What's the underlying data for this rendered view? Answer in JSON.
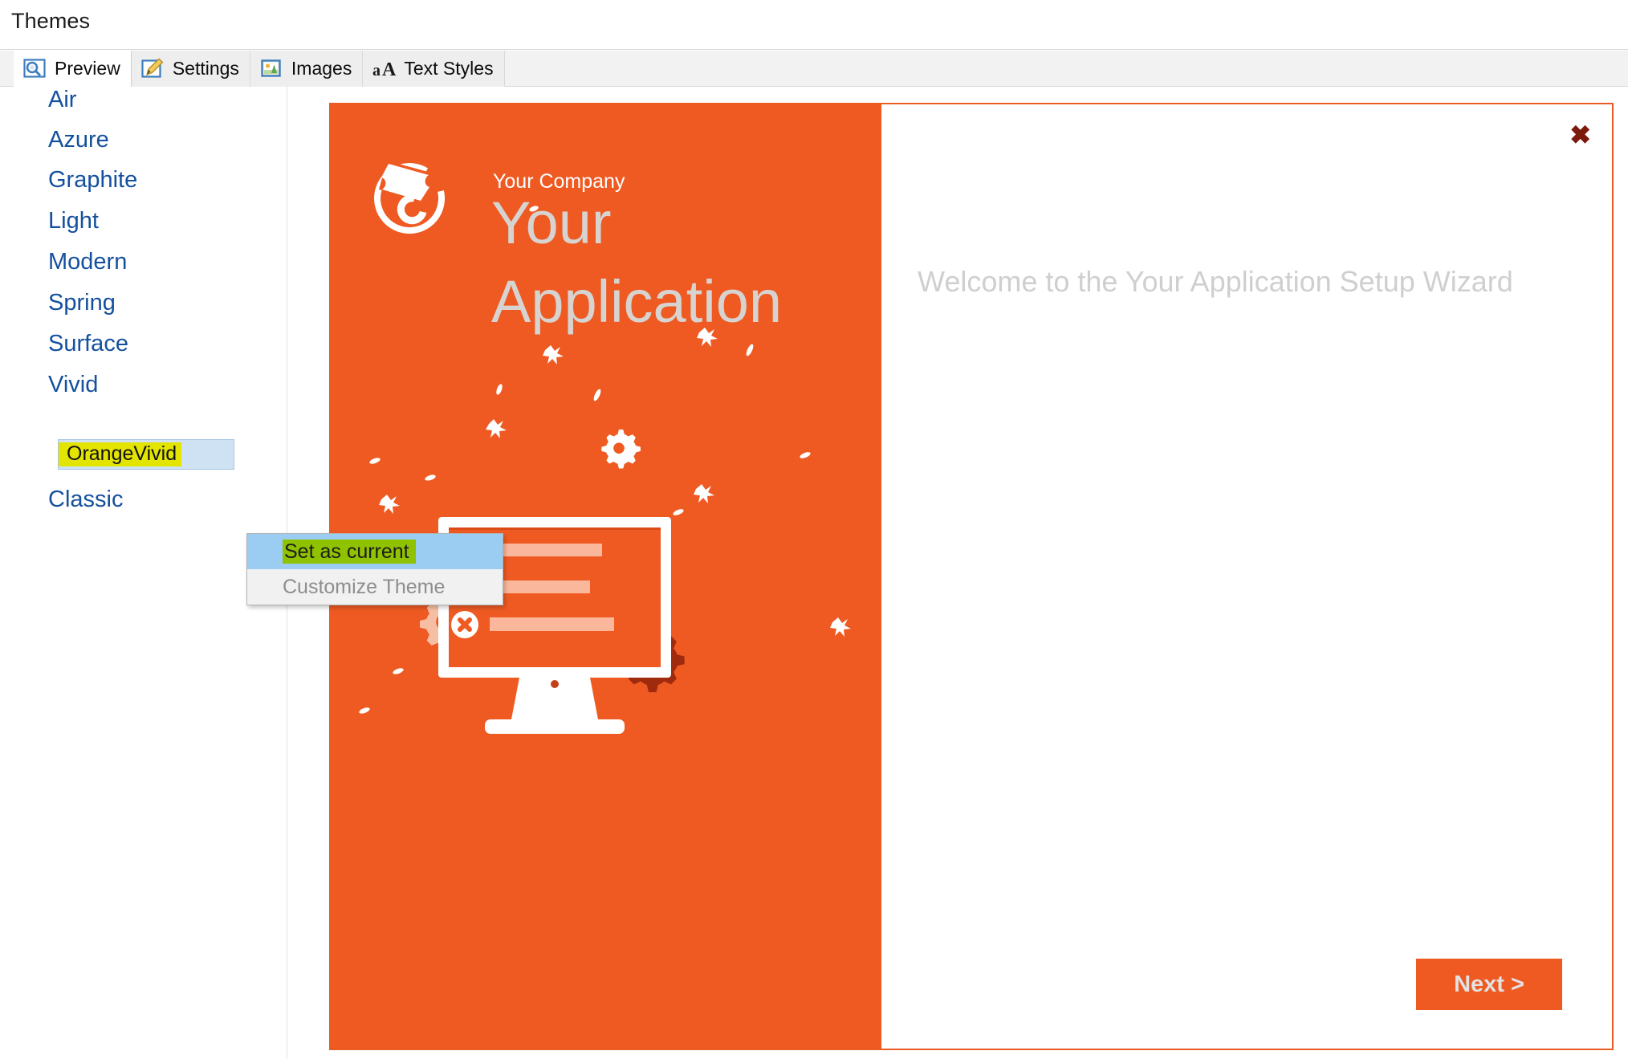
{
  "window": {
    "title": "Themes"
  },
  "tabs": [
    {
      "label": "Preview",
      "icon": "preview-icon",
      "active": true
    },
    {
      "label": "Settings",
      "icon": "pencil-icon",
      "active": false
    },
    {
      "label": "Images",
      "icon": "image-icon",
      "active": false
    },
    {
      "label": "Text Styles",
      "icon": "text-styles-icon",
      "active": false
    }
  ],
  "theme_list": {
    "items": [
      {
        "label": "Air"
      },
      {
        "label": "Azure"
      },
      {
        "label": "Graphite"
      },
      {
        "label": "Light"
      },
      {
        "label": "Modern"
      },
      {
        "label": "Spring"
      },
      {
        "label": "Surface"
      },
      {
        "label": "Vivid"
      },
      {
        "label": "Classic"
      }
    ],
    "selected_child": "OrangeVivid"
  },
  "context_menu": {
    "items": [
      {
        "label": "Set as current",
        "state": "hovered"
      },
      {
        "label": "Customize Theme",
        "state": "disabled"
      }
    ]
  },
  "wizard": {
    "company": "Your Company",
    "app_name": "Your\nApplication",
    "welcome": "Welcome to the Your Application Setup Wizard",
    "next_label": "Next >",
    "close_label": "✖"
  },
  "colors": {
    "accent_orange": "#ee5a22",
    "link_blue": "#14509e",
    "selection_blue": "#cfe2f3",
    "hover_blue": "#9bcdf2",
    "highlight_yellow": "#e3e400",
    "highlight_green": "#8fc200",
    "close_red": "#7d1a0e",
    "muted_gray": "#cfcfcf"
  }
}
